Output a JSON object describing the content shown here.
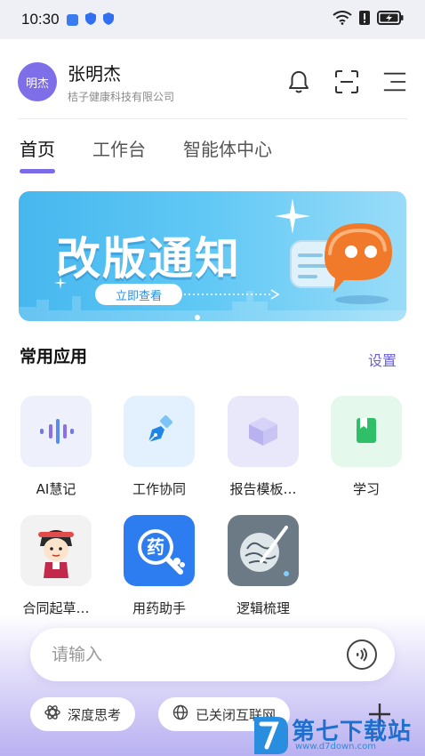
{
  "status_bar": {
    "time": "10:30",
    "icons": [
      "notification-app-icon",
      "shield-icon",
      "shield-icon",
      "wifi-icon",
      "sim-alert-icon",
      "battery-charging-icon"
    ]
  },
  "header": {
    "avatar_text": "明杰",
    "user_name": "张明杰",
    "company": "桔子健康科技有限公司",
    "actions": [
      "bell-icon",
      "scan-icon",
      "menu-icon"
    ]
  },
  "tabs": [
    {
      "label": "首页",
      "active": true
    },
    {
      "label": "工作台",
      "active": false
    },
    {
      "label": "智能体中心",
      "active": false
    }
  ],
  "banner": {
    "title": "改版通知",
    "cta": "立即查看",
    "colors": {
      "start": "#46b7ee",
      "end": "#9adcf8"
    }
  },
  "common_apps": {
    "title": "常用应用",
    "settings_label": "设置",
    "items": [
      {
        "label": "AI慧记",
        "icon": "voice-wave-icon"
      },
      {
        "label": "工作协同",
        "icon": "pen-nib-icon"
      },
      {
        "label": "报告模板…",
        "icon": "cube-icon"
      },
      {
        "label": "学习",
        "icon": "book-icon"
      },
      {
        "label": "合同起草…",
        "icon": "cartoon-avatar-icon"
      },
      {
        "label": "用药助手",
        "icon": "medicine-search-icon"
      },
      {
        "label": "逻辑梳理",
        "icon": "brain-pen-icon"
      }
    ]
  },
  "input_bar": {
    "placeholder": "请输入",
    "voice_icon": "voice-input-icon"
  },
  "chips": [
    {
      "label": "深度思考",
      "icon": "atom-icon"
    },
    {
      "label": "已关闭互联网",
      "icon": "globe-icon"
    }
  ],
  "watermark": {
    "text": "第七下载站",
    "url": "www.d7down.com"
  },
  "accent_color": "#7a6ce6"
}
